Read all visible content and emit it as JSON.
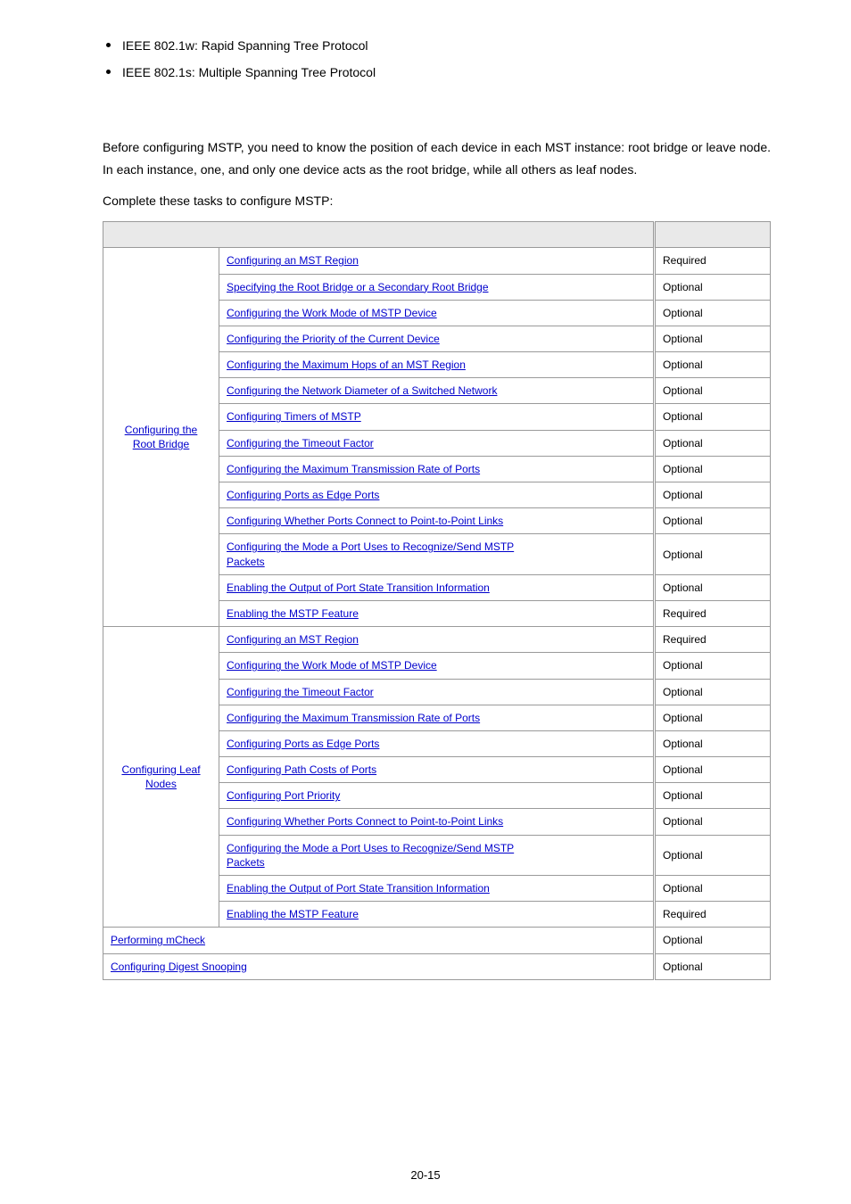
{
  "bullets": [
    "IEEE 802.1w: Rapid Spanning Tree Protocol",
    "IEEE 802.1s: Multiple Spanning Tree Protocol"
  ],
  "intro": {
    "p1": "Before configuring MSTP, you need to know the position of each device in each MST instance: root bridge or leave node. In each instance, one, and only one device acts as the root bridge, while all others as leaf nodes.",
    "p2": "Complete these tasks to configure MSTP:"
  },
  "groups": {
    "rootBridge": {
      "label_l1": "Configuring the",
      "label_l2": "Root Bridge"
    },
    "leafNodes": {
      "label_l1": "Configuring Leaf",
      "label_l2": "Nodes"
    }
  },
  "rows": {
    "r1": {
      "task": "Configuring an MST Region",
      "rem": "Required"
    },
    "r2": {
      "task": "Specifying the Root Bridge or a Secondary Root Bridge",
      "rem": "Optional"
    },
    "r3": {
      "task": "Configuring the Work Mode of MSTP Device",
      "rem": "Optional"
    },
    "r4": {
      "task": "Configuring the Priority of the Current Device",
      "rem": "Optional"
    },
    "r5": {
      "task": "Configuring the Maximum Hops of an MST Region",
      "rem": "Optional"
    },
    "r6": {
      "task": "Configuring the Network Diameter of a Switched Network",
      "rem": "Optional"
    },
    "r7": {
      "task": "Configuring Timers of MSTP",
      "rem": "Optional"
    },
    "r8": {
      "task": "Configuring the Timeout Factor",
      "rem": "Optional"
    },
    "r9": {
      "task": "Configuring the Maximum Transmission Rate of Ports",
      "rem": "Optional"
    },
    "r10": {
      "task": "Configuring Ports as Edge Ports",
      "rem": "Optional"
    },
    "r11": {
      "task": "Configuring Whether Ports Connect to Point-to-Point Links",
      "rem": "Optional"
    },
    "r12": {
      "task_l1": "Configuring the Mode a Port Uses to Recognize/Send MSTP",
      "task_l2": "Packets",
      "rem": "Optional"
    },
    "r13": {
      "task": "Enabling the Output of Port State Transition Information",
      "rem": "Optional"
    },
    "r14": {
      "task": "Enabling the MSTP Feature",
      "rem": "Required"
    },
    "r15": {
      "task": "Configuring an MST Region",
      "rem": "Required"
    },
    "r16": {
      "task": "Configuring the Work Mode of MSTP Device",
      "rem": "Optional"
    },
    "r17": {
      "task": "Configuring the Timeout Factor",
      "rem": "Optional"
    },
    "r18": {
      "task": "Configuring the Maximum Transmission Rate of Ports",
      "rem": "Optional"
    },
    "r19": {
      "task": "Configuring Ports as Edge Ports",
      "rem": "Optional"
    },
    "r20": {
      "task": "Configuring Path Costs of Ports",
      "rem": "Optional"
    },
    "r21": {
      "task": "Configuring Port Priority",
      "rem": "Optional"
    },
    "r22": {
      "task": "Configuring Whether Ports Connect to Point-to-Point Links",
      "rem": "Optional"
    },
    "r23": {
      "task_l1": "Configuring the Mode a Port Uses to Recognize/Send MSTP",
      "task_l2": "Packets",
      "rem": "Optional"
    },
    "r24": {
      "task": "Enabling the Output of Port State Transition Information",
      "rem": "Optional"
    },
    "r25": {
      "task": "Enabling the MSTP Feature",
      "rem": "Required"
    },
    "r26": {
      "task": "Performing mCheck",
      "rem": "Optional"
    },
    "r27": {
      "task": "Configuring Digest Snooping",
      "rem": "Optional"
    }
  },
  "pageNumber": "20-15"
}
